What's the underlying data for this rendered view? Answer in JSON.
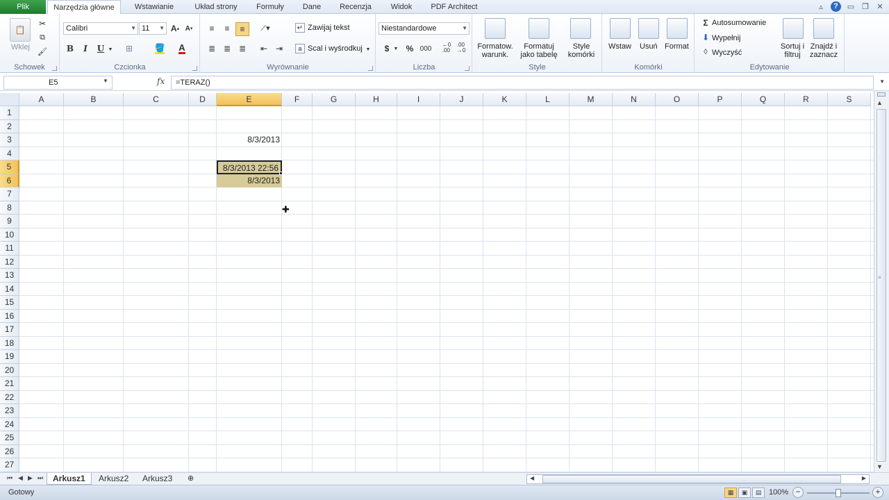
{
  "tabs": {
    "file": "Plik",
    "items": [
      "Narzędzia główne",
      "Wstawianie",
      "Układ strony",
      "Formuły",
      "Dane",
      "Recenzja",
      "Widok",
      "PDF Architect"
    ],
    "active_index": 0
  },
  "ribbon": {
    "clipboard": {
      "label": "Schowek",
      "paste": "Wklej"
    },
    "font": {
      "label": "Czcionka",
      "family": "Calibri",
      "size": "11",
      "bold": "B",
      "italic": "I",
      "underline": "U"
    },
    "alignment": {
      "label": "Wyrównanie",
      "wrap_text": "Zawijaj tekst",
      "merge": "Scal i wyśrodkuj"
    },
    "number": {
      "label": "Liczba",
      "format": "Niestandardowe",
      "currency": "$",
      "percent": "%",
      "thousands": "000"
    },
    "styles": {
      "label": "Style",
      "conditional": "Formatow.\nwarunk.",
      "format_table": "Formatuj\njako tabelę",
      "cell_styles": "Style\nkomórki"
    },
    "cells": {
      "label": "Komórki",
      "insert": "Wstaw",
      "delete": "Usuń",
      "format": "Format"
    },
    "editing": {
      "label": "Edytowanie",
      "autosum": "Autosumowanie",
      "fill": "Wypełnij",
      "clear": "Wyczyść",
      "sort_filter": "Sortuj i\nfiltruj",
      "find_select": "Znajdź i\nzaznacz"
    }
  },
  "formula_bar": {
    "name_box": "E5",
    "fx": "fx",
    "formula": "=TERAZ()"
  },
  "grid": {
    "columns": [
      "A",
      "B",
      "C",
      "D",
      "E",
      "F",
      "G",
      "H",
      "I",
      "J",
      "K",
      "L",
      "M",
      "N",
      "O",
      "P",
      "Q",
      "R",
      "S"
    ],
    "rows": 27,
    "selected_column": "E",
    "selected_rows": [
      5,
      6
    ],
    "cells": {
      "E3": "8/3/2013",
      "E5": "8/3/2013 22:56",
      "E6": "8/3/2013"
    }
  },
  "sheets": {
    "items": [
      "Arkusz1",
      "Arkusz2",
      "Arkusz3"
    ],
    "active_index": 0
  },
  "status": {
    "text": "Gotowy",
    "zoom": "100%"
  },
  "colors": {
    "accent_green": "#1f7a2e",
    "selection": "#d6cb99",
    "header_highlight": "#f1c15a"
  }
}
